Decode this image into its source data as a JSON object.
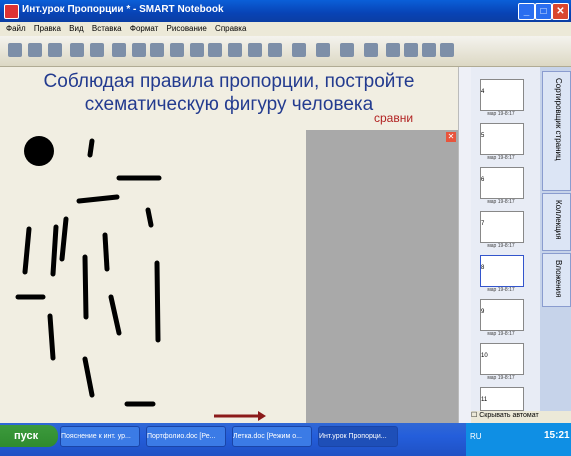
{
  "window": {
    "title": "Инт.урок Пропорции * - SMART Notebook"
  },
  "menu": [
    "Файл",
    "Правка",
    "Вид",
    "Вставка",
    "Формат",
    "Рисование",
    "Справка"
  ],
  "page": {
    "title_line1": "Соблюдая правила пропорции, постройте",
    "title_line2": "схематическую фигуру человека",
    "compare": "сравни"
  },
  "sidebar": {
    "pages": [
      {
        "num": "4",
        "date": "мар 19-8:17"
      },
      {
        "num": "5",
        "date": "мар 19-8:17"
      },
      {
        "num": "6",
        "date": "мар 19-8:17"
      },
      {
        "num": "7",
        "date": "мар 19-8:17"
      },
      {
        "num": "8",
        "date": "мар 19-8:17"
      },
      {
        "num": "9",
        "date": "мар 19-8:17"
      },
      {
        "num": "10",
        "date": "мар 19-8:17"
      },
      {
        "num": "11",
        "date": ""
      }
    ],
    "autohide": "Скрывать автомат"
  },
  "tabs": [
    "Сортировщик страниц",
    "Коллекция",
    "Вложения"
  ],
  "taskbar": {
    "start": "пуск",
    "tasks": [
      "Пояснение к инт. ур...",
      "Портфолио.doc [Ре...",
      "Летка.doc [Режим о...",
      "Инт.урок Пропорци..."
    ],
    "lang": "RU",
    "clock": "15:21"
  }
}
